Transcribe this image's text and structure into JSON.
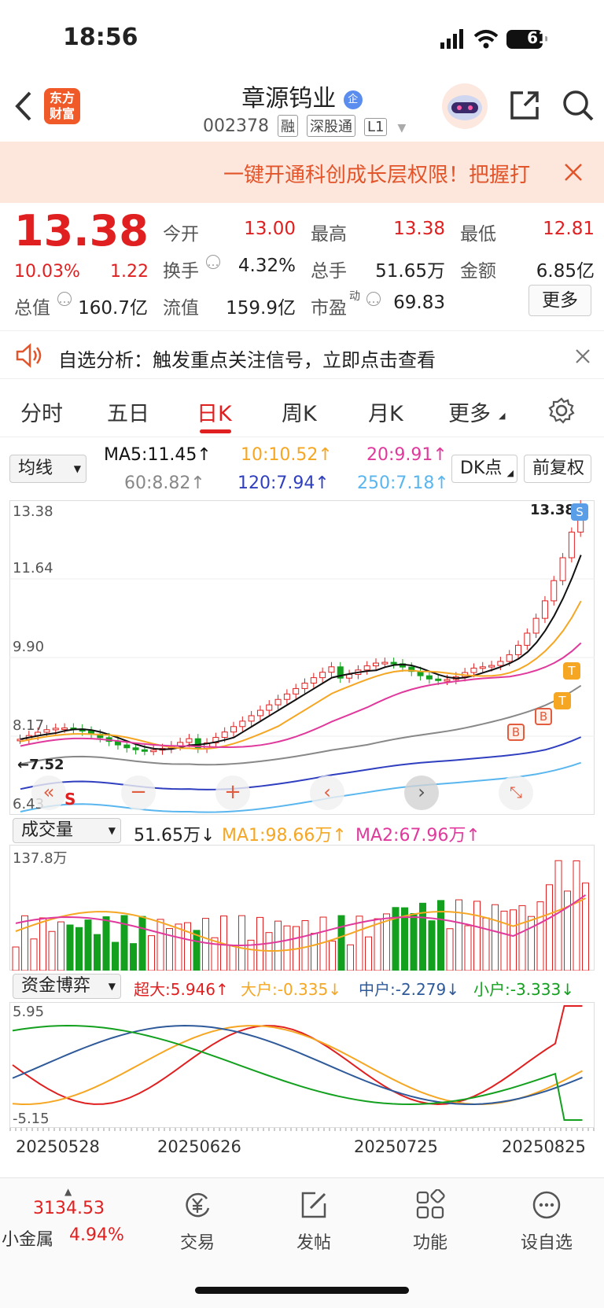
{
  "status_bar": {
    "time": "18:56",
    "battery": "61"
  },
  "header": {
    "logo_text": "东方财富",
    "title": "章源钨业",
    "title_badge": "企",
    "code": "002378",
    "tags": [
      "融",
      "深股通",
      "L1"
    ]
  },
  "banner": {
    "text": "一键开通科创成长层权限！把握打"
  },
  "quote": {
    "price": "13.38",
    "change_pct": "10.03%",
    "change": "1.22",
    "fields": [
      {
        "label": "今开",
        "value": "13.00"
      },
      {
        "label": "最高",
        "value": "13.38"
      },
      {
        "label": "最低",
        "value": "12.81"
      },
      {
        "label": "换手",
        "value": "4.32%"
      },
      {
        "label": "总手",
        "value": "51.65万"
      },
      {
        "label": "金额",
        "value": "6.85亿"
      },
      {
        "label": "流值",
        "value": "159.9亿"
      },
      {
        "label": "市盈",
        "value": "69.83"
      }
    ],
    "total_value_label": "总值",
    "total_value": "160.7亿",
    "pe_sup": "动",
    "more_label": "更多"
  },
  "tip": {
    "text": "自选分析：触发重点关注信号，立即点击查看"
  },
  "tabs": [
    "分时",
    "五日",
    "日K",
    "周K",
    "月K",
    "更多"
  ],
  "active_tab": "日K",
  "ma_bar": {
    "selector": "均线",
    "ma5": "MA5:11.45↑",
    "ma10": "10:10.52↑",
    "ma20": "20:9.91↑",
    "ma60": "60:8.82↑",
    "ma120": "120:7.94↑",
    "ma250": "250:7.18↑",
    "dk_button": "DK点",
    "fq_button": "前复权"
  },
  "kline": {
    "y_labels": [
      "13.38",
      "11.64",
      "9.90",
      "8.17",
      "6.43"
    ],
    "high_marker": "13.38",
    "low_marker": "←7.52",
    "s_mark": "S",
    "signals": [
      "B",
      "B",
      "T",
      "T",
      "S"
    ]
  },
  "volume": {
    "selector": "成交量",
    "vol": "51.65万↓",
    "ma1": "MA1:98.66万↑",
    "ma2": "MA2:67.96万↑",
    "y_max": "137.8万"
  },
  "fund": {
    "selector": "资金博弈",
    "super": "超大:5.946↑",
    "large": "大户:-0.335↓",
    "medium": "中户:-2.279↓",
    "small": "小户:-3.333↓",
    "y_top": "5.95",
    "y_bottom": "-5.15"
  },
  "dates": [
    "20250528",
    "20250626",
    "20250725",
    "20250825"
  ],
  "bottom_nav": {
    "index_value": "3134.53",
    "index_name": "小金属",
    "index_pct": "4.94%",
    "items": [
      "交易",
      "发帖",
      "功能",
      "设自选"
    ]
  },
  "colors": {
    "up": "#e02020",
    "down": "#13a01e",
    "ma5": "#111111",
    "ma10": "#f5a623",
    "ma20": "#e0399c",
    "ma60": "#888888",
    "ma120": "#2f3fbf",
    "ma250": "#5ab6ee"
  }
}
